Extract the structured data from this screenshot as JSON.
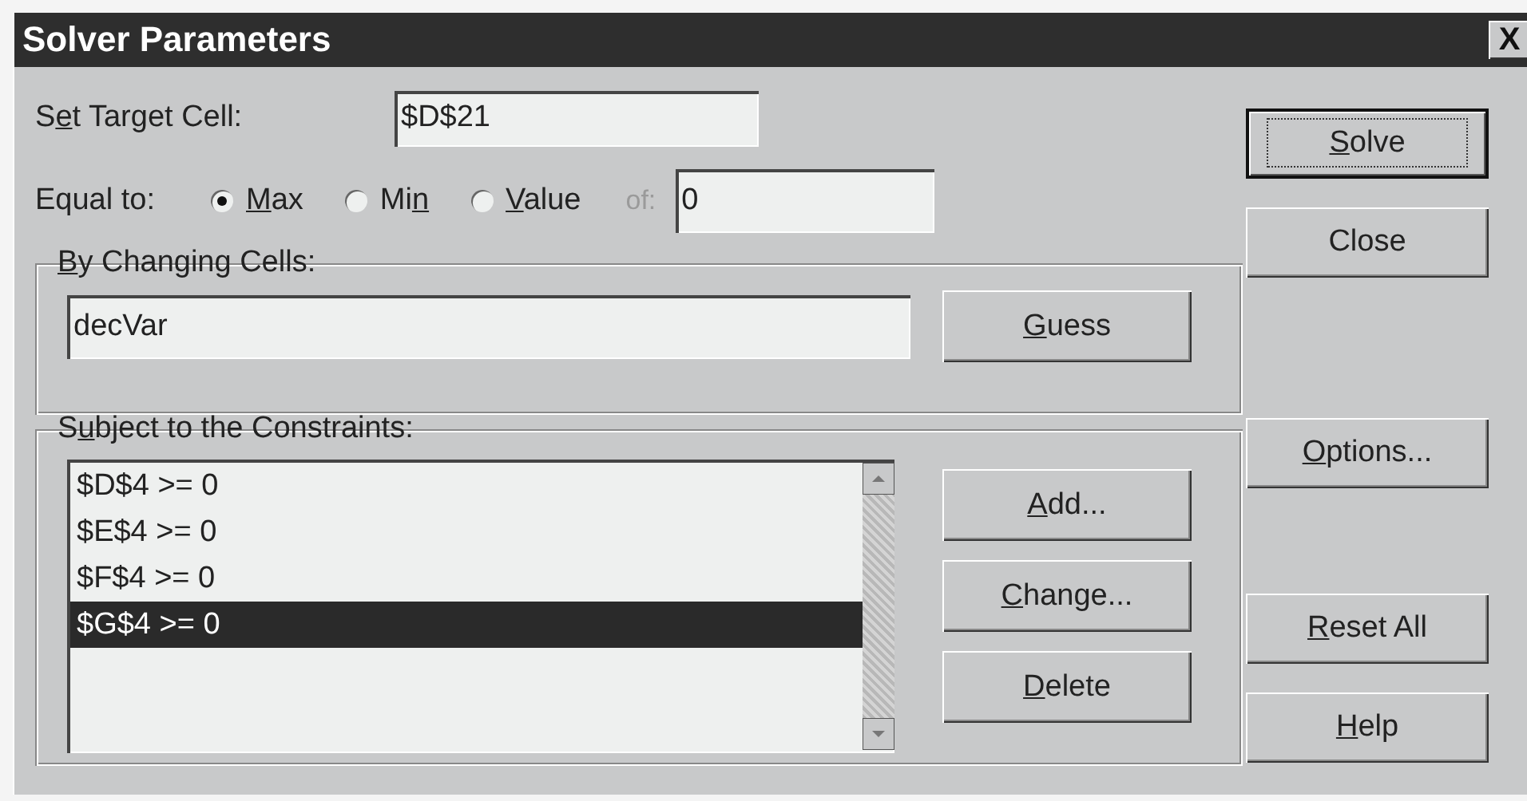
{
  "window": {
    "title": "Solver Parameters",
    "close_glyph": "X"
  },
  "target": {
    "label": {
      "pre": "S",
      "key": "e",
      "post": "t Target Cell:"
    },
    "value": "$D$21"
  },
  "equal_to": {
    "label": "Equal to:",
    "options": [
      {
        "text": {
          "key": "M",
          "post": "ax"
        },
        "selected": true
      },
      {
        "text": {
          "pre": "Mi",
          "key": "n"
        },
        "selected": false
      },
      {
        "text": {
          "key": "V",
          "post": "alue"
        },
        "selected": false
      }
    ],
    "of_label": {
      "text": "of:",
      "disabled": true
    },
    "value": "0"
  },
  "changing": {
    "title": {
      "key": "B",
      "post": "y Changing Cells:"
    },
    "value": "decVar",
    "button": {
      "key": "G",
      "post": "uess"
    }
  },
  "constraints": {
    "title": {
      "pre": "S",
      "key": "u",
      "post": "bject to the Constraints:"
    },
    "items": [
      {
        "text": "$D$4 >= 0",
        "selected": false
      },
      {
        "text": "$E$4 >= 0",
        "selected": false
      },
      {
        "text": "$F$4 >= 0",
        "selected": false
      },
      {
        "text": "$G$4 >= 0",
        "selected": true
      }
    ],
    "buttons": [
      {
        "key": "A",
        "post": "dd..."
      },
      {
        "key": "C",
        "post": "hange..."
      },
      {
        "key": "D",
        "post": "elete"
      }
    ]
  },
  "side_buttons": [
    {
      "label": {
        "key": "S",
        "post": "olve"
      },
      "default": true
    },
    {
      "label": {
        "pre": "Close"
      },
      "default": false
    },
    {
      "label": {
        "key": "O",
        "post": "ptions..."
      },
      "default": false
    },
    {
      "label": {
        "key": "R",
        "post": "eset All"
      },
      "default": false
    },
    {
      "label": {
        "key": "H",
        "post": "elp"
      },
      "default": false
    }
  ]
}
